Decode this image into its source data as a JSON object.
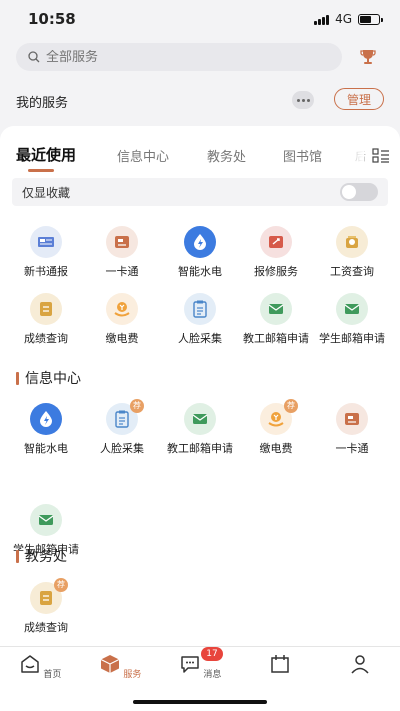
{
  "status": {
    "time": "10:58",
    "network": "4G",
    "battery_level": 0.6
  },
  "search": {
    "placeholder": "全部服务"
  },
  "my_services": {
    "label": "我的服务",
    "manage_label": "管理"
  },
  "tabs": [
    {
      "label": "最近使用"
    },
    {
      "label": "信息中心"
    },
    {
      "label": "教务处"
    },
    {
      "label": "图书馆"
    },
    {
      "label": "后"
    }
  ],
  "favorites": {
    "label": "仅显收藏",
    "enabled": false
  },
  "recent": [
    {
      "label": "新书通报",
      "icon": "book-news-icon"
    },
    {
      "label": "一卡通",
      "icon": "campus-card-icon"
    },
    {
      "label": "智能水电",
      "icon": "water-electric-icon"
    },
    {
      "label": "报修服务",
      "icon": "repair-ticket-icon"
    },
    {
      "label": "工资查询",
      "icon": "salary-icon"
    },
    {
      "label": "成绩查询",
      "icon": "grade-icon"
    },
    {
      "label": "缴电费",
      "icon": "pay-electric-icon"
    },
    {
      "label": "人脸采集",
      "icon": "face-clipboard-icon"
    },
    {
      "label": "教工邮箱申请",
      "icon": "mail-icon"
    },
    {
      "label": "学生邮箱申请",
      "icon": "mail-icon"
    }
  ],
  "info_center": {
    "title": "信息中心",
    "items": [
      {
        "label": "智能水电",
        "icon": "water-electric-icon",
        "badge": ""
      },
      {
        "label": "人脸采集",
        "icon": "face-clipboard-icon",
        "badge": "荐"
      },
      {
        "label": "教工邮箱申请",
        "icon": "mail-icon",
        "badge": ""
      },
      {
        "label": "缴电费",
        "icon": "pay-electric-icon",
        "badge": "荐"
      },
      {
        "label": "一卡通",
        "icon": "campus-card-icon",
        "badge": ""
      },
      {
        "label": "学生邮箱申请",
        "icon": "mail-icon",
        "badge": ""
      }
    ]
  },
  "academic": {
    "title": "教务处",
    "items": [
      {
        "label": "成绩查询",
        "icon": "grade-icon",
        "badge": "荐"
      }
    ]
  },
  "nav": [
    {
      "label": "首页",
      "icon": "home-icon"
    },
    {
      "label": "服务",
      "icon": "service-box-icon"
    },
    {
      "label": "消息",
      "icon": "message-icon",
      "badge": "17"
    },
    {
      "label": "",
      "icon": "calendar-icon"
    },
    {
      "label": "",
      "icon": "profile-icon"
    }
  ],
  "colors": {
    "accent": "#c9704a",
    "badge": "#e8453c"
  }
}
